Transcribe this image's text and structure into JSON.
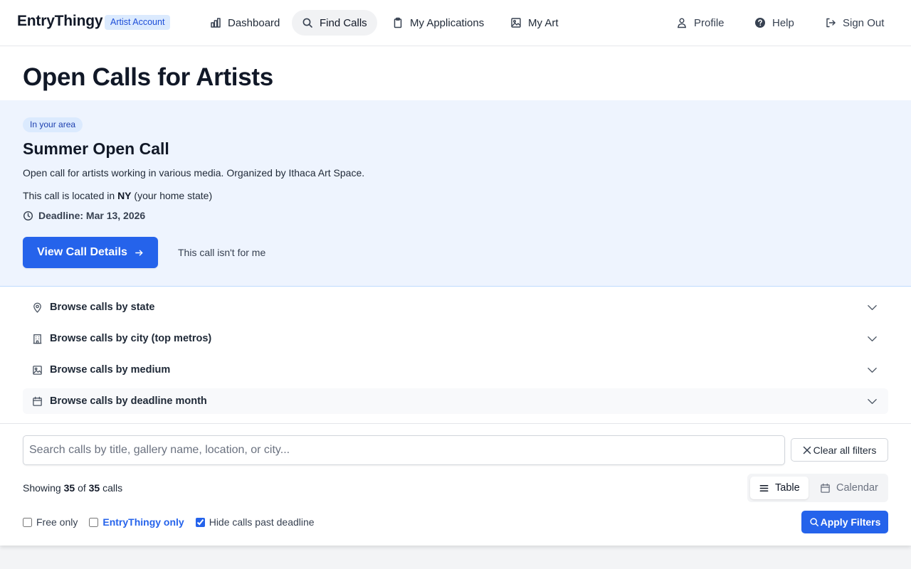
{
  "nav": {
    "brand": "EntryThingy",
    "account_badge": "Artist Account",
    "items": [
      {
        "label": "Dashboard",
        "icon": "bar-chart-icon",
        "active": false
      },
      {
        "label": "Find Calls",
        "icon": "search-icon",
        "active": true
      },
      {
        "label": "My Applications",
        "icon": "clipboard-icon",
        "active": false
      },
      {
        "label": "My Art",
        "icon": "image-icon",
        "active": false
      }
    ],
    "right_items": [
      {
        "label": "Profile",
        "icon": "user-icon"
      },
      {
        "label": "Help",
        "icon": "help-circle-icon"
      },
      {
        "label": "Sign Out",
        "icon": "sign-out-icon"
      }
    ]
  },
  "page": {
    "title": "Open Calls for Artists"
  },
  "featured": {
    "badge": "In your area",
    "title": "Summer Open Call",
    "description": "Open call for artists working in various media. Organized by Ithaca Art Space.",
    "location_prefix": "This call is located in",
    "location_state": "NY",
    "location_suffix": "(your home state)",
    "deadline": "Deadline: Mar 13, 2026",
    "primary_button": "View Call Details",
    "dismiss": "This call isn't for me"
  },
  "browse": {
    "items": [
      {
        "label": "Browse calls by state",
        "icon": "map-pin-icon"
      },
      {
        "label": "Browse calls by city (top metros)",
        "icon": "building-icon"
      },
      {
        "label": "Browse calls by medium",
        "icon": "image-icon"
      },
      {
        "label": "Browse calls by deadline month",
        "icon": "calendar-icon"
      }
    ]
  },
  "filters": {
    "search_placeholder": "Search calls by title, gallery name, location, or city...",
    "search_value": "",
    "clear_button": "Clear all filters",
    "showing_prefix": "Showing",
    "showing_count": "35",
    "showing_of": "of",
    "showing_total": "35",
    "showing_suffix": "calls",
    "view_options": [
      {
        "label": "Table",
        "icon": "list-icon",
        "active": true
      },
      {
        "label": "Calendar",
        "icon": "calendar-icon",
        "active": false
      }
    ],
    "checkboxes": [
      {
        "label": "Free only",
        "checked": false
      },
      {
        "label": "EntryThingy only",
        "checked": false
      },
      {
        "label": "Hide calls past deadline",
        "checked": true
      }
    ],
    "apply_button": "Apply Filters"
  },
  "colors": {
    "primary": "#2563eb",
    "featured_bg": "#eef4fe",
    "badge_bg": "#dbeafe",
    "text_dark": "#111827"
  }
}
